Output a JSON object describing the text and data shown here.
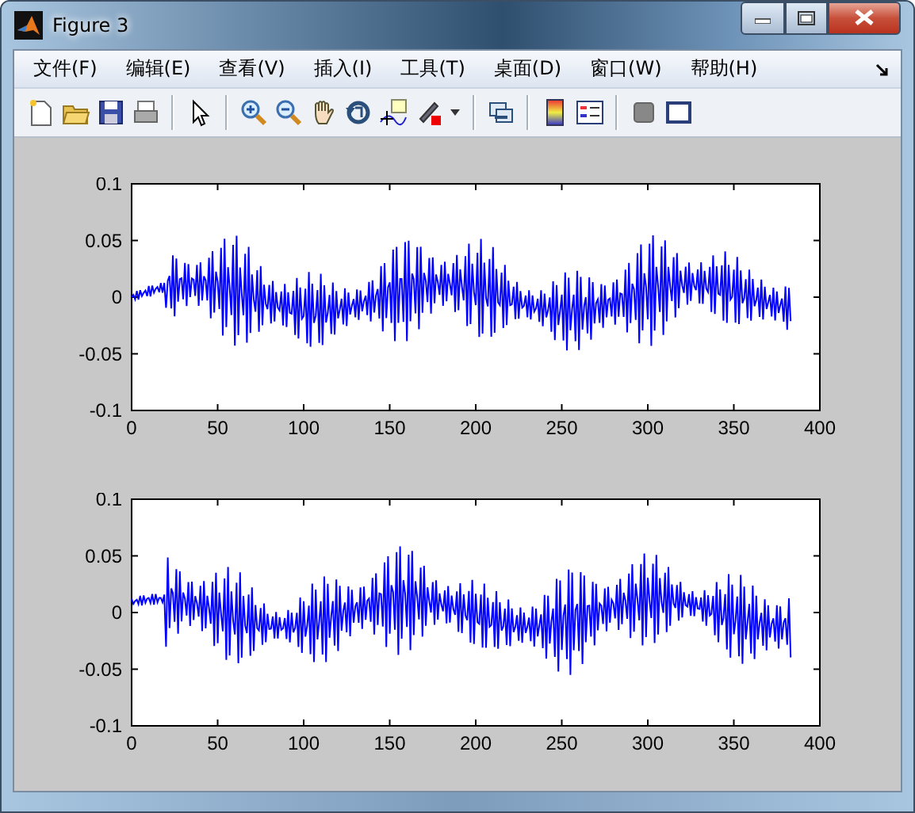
{
  "window": {
    "title": "Figure 3"
  },
  "menu": [
    "文件(F)",
    "编辑(E)",
    "查看(V)",
    "插入(I)",
    "工具(T)",
    "桌面(D)",
    "窗口(W)",
    "帮助(H)"
  ],
  "axes": [
    {
      "yticks": [
        "0.1",
        "0.05",
        "0",
        "-0.05",
        "-0.1"
      ],
      "xticks": [
        "0",
        "50",
        "100",
        "150",
        "200",
        "250",
        "300",
        "350",
        "400"
      ]
    },
    {
      "yticks": [
        "0.1",
        "0.05",
        "0",
        "-0.05",
        "-0.1"
      ],
      "xticks": [
        "0",
        "50",
        "100",
        "150",
        "200",
        "250",
        "300",
        "350",
        "400"
      ]
    }
  ]
}
